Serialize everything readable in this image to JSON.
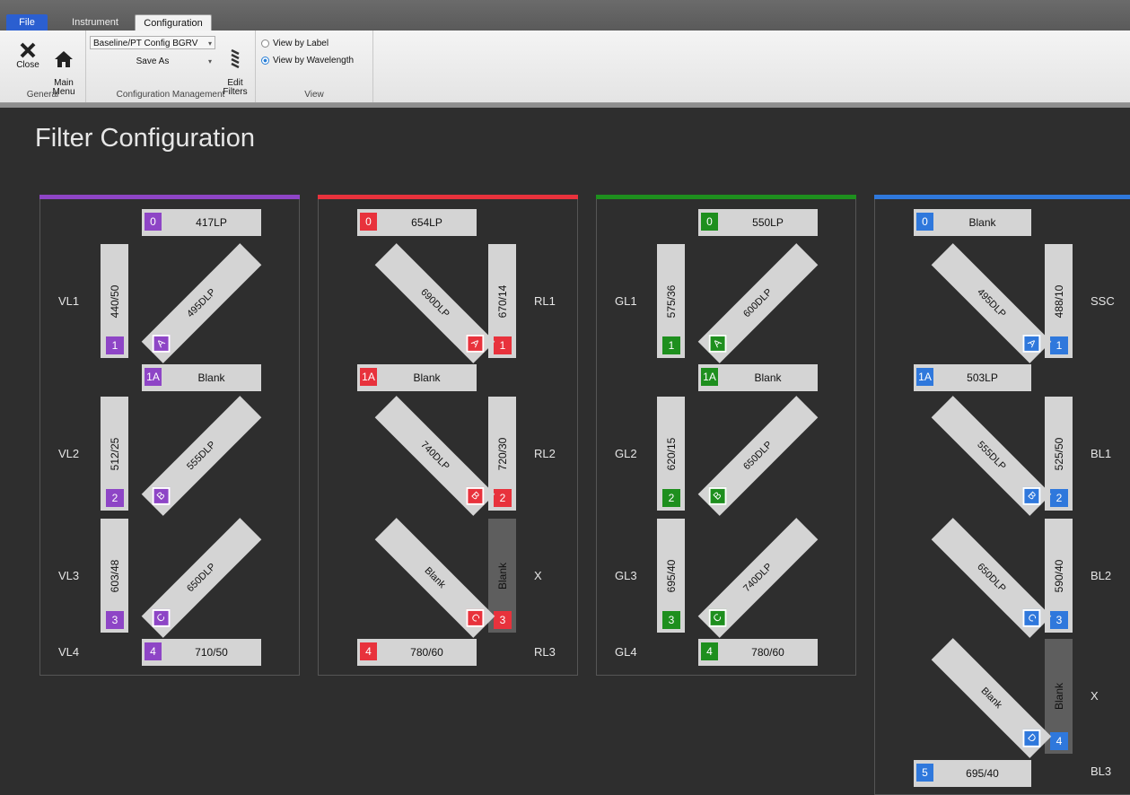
{
  "menu": {
    "file": "File",
    "instrument": "Instrument",
    "configuration": "Configuration"
  },
  "ribbon": {
    "close": "Close",
    "main_menu": "Main\nMenu",
    "general_group": "General",
    "config_select": "Baseline/PT Config BGRV",
    "save_as": "Save As",
    "edit_filters": "Edit\nFilters",
    "config_group": "Configuration Management",
    "view_by_label": "View by Label",
    "view_by_wavelength": "View by Wavelength",
    "view_group": "View",
    "selected_view": "View by Wavelength"
  },
  "page_title": "Filter Configuration",
  "colors": {
    "violet": "#8e45c6",
    "red": "#e8323c",
    "green": "#1e8f1e",
    "blue": "#2f78dc"
  },
  "panels": [
    {
      "name": "violet",
      "color": "#8e45c6",
      "top_filter": {
        "badge": "0",
        "label": "417LP"
      },
      "mid_filter": {
        "badge": "1A",
        "label": "Blank"
      },
      "bottom_filter": {
        "badge": "4",
        "label": "710/50"
      },
      "rows": [
        {
          "channel": "VL1",
          "filter": {
            "label": "440/50",
            "badge": "1"
          },
          "dichroic": {
            "label": "495DLP",
            "badge": "A"
          }
        },
        {
          "channel": "VL2",
          "filter": {
            "label": "512/25",
            "badge": "2"
          },
          "dichroic": {
            "label": "555DLP",
            "badge": "B"
          }
        },
        {
          "channel": "VL3",
          "filter": {
            "label": "603/48",
            "badge": "3"
          },
          "dichroic": {
            "label": "650DLP",
            "badge": "C"
          }
        }
      ],
      "last_channel": "VL4"
    },
    {
      "name": "red",
      "color": "#e8323c",
      "top_filter": {
        "badge": "0",
        "label": "654LP"
      },
      "mid_filter": {
        "badge": "1A",
        "label": "Blank"
      },
      "bottom_filter": {
        "badge": "4",
        "label": "780/60"
      },
      "rows": [
        {
          "channel": "RL1",
          "filter": {
            "label": "670/14",
            "badge": "1"
          },
          "dichroic": {
            "label": "690DLP",
            "badge": "A"
          }
        },
        {
          "channel": "RL2",
          "filter": {
            "label": "720/30",
            "badge": "2"
          },
          "dichroic": {
            "label": "740DLP",
            "badge": "B"
          }
        },
        {
          "channel": "X",
          "filter": {
            "label": "Blank",
            "badge": "3"
          },
          "dichroic": {
            "label": "Blank",
            "badge": "C"
          }
        }
      ],
      "last_channel": "RL3"
    },
    {
      "name": "green",
      "color": "#1e8f1e",
      "top_filter": {
        "badge": "0",
        "label": "550LP"
      },
      "mid_filter": {
        "badge": "1A",
        "label": "Blank"
      },
      "bottom_filter": {
        "badge": "4",
        "label": "780/60"
      },
      "rows": [
        {
          "channel": "GL1",
          "filter": {
            "label": "575/36",
            "badge": "1"
          },
          "dichroic": {
            "label": "600DLP",
            "badge": "A"
          }
        },
        {
          "channel": "GL2",
          "filter": {
            "label": "620/15",
            "badge": "2"
          },
          "dichroic": {
            "label": "650DLP",
            "badge": "B"
          }
        },
        {
          "channel": "GL3",
          "filter": {
            "label": "695/40",
            "badge": "3"
          },
          "dichroic": {
            "label": "740DLP",
            "badge": "C"
          }
        }
      ],
      "last_channel": "GL4"
    },
    {
      "name": "blue",
      "color": "#2f78dc",
      "top_filter": {
        "badge": "0",
        "label": "Blank"
      },
      "mid_filter": {
        "badge": "1A",
        "label": "503LP"
      },
      "bottom_filter": {
        "badge": "5",
        "label": "695/40"
      },
      "rows": [
        {
          "channel": "SSC",
          "filter": {
            "label": "488/10",
            "badge": "1"
          },
          "dichroic": {
            "label": "495DLP",
            "badge": "A"
          }
        },
        {
          "channel": "BL1",
          "filter": {
            "label": "525/50",
            "badge": "2"
          },
          "dichroic": {
            "label": "555DLP",
            "badge": "B"
          }
        },
        {
          "channel": "BL2",
          "filter": {
            "label": "590/40",
            "badge": "3"
          },
          "dichroic": {
            "label": "650DLP",
            "badge": "C"
          }
        },
        {
          "channel": "X",
          "filter": {
            "label": "Blank",
            "badge": "4"
          },
          "dichroic": {
            "label": "Blank",
            "badge": "D"
          }
        }
      ],
      "last_channel": "BL3"
    }
  ]
}
